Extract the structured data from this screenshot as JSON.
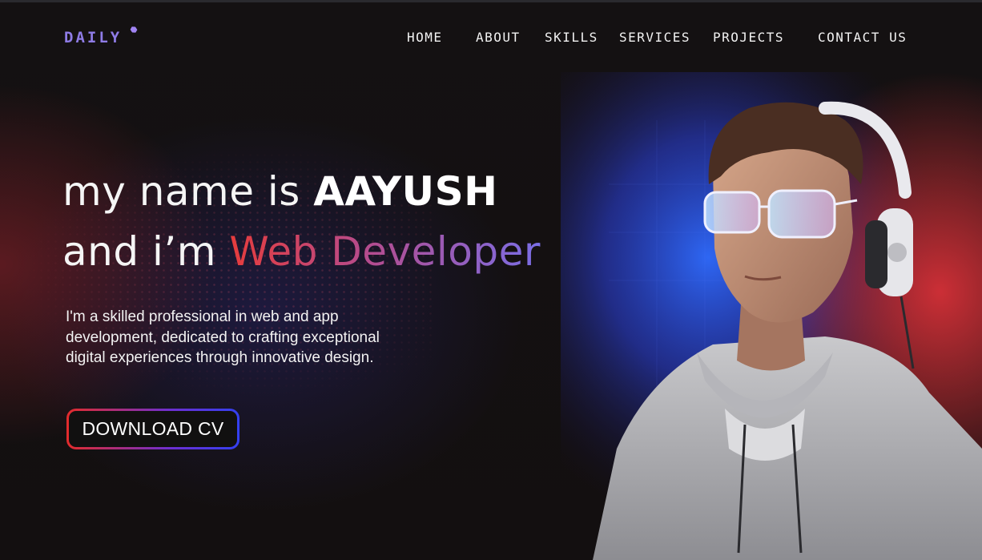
{
  "header": {
    "logo": "DAILY",
    "nav": [
      {
        "label": "HOME"
      },
      {
        "label": "ABOUT"
      },
      {
        "label": "SKILLS"
      },
      {
        "label": "SERVICES"
      },
      {
        "label": "PROJECTS"
      },
      {
        "label": "CONTACT US"
      }
    ]
  },
  "hero": {
    "line1_prefix": "my name is ",
    "name": "AAYUSH",
    "line2_prefix": "and i’m ",
    "role": "Web Developer",
    "description": "I'm a skilled professional in web and app development, dedicated to crafting exceptional digital experiences through innovative design.",
    "cta_label": "DOWNLOAD CV"
  },
  "colors": {
    "background": "#120f10",
    "logo": "#8f7ce6",
    "role_gradient_start": "#e63c3c",
    "role_gradient_end": "#7a6ee6",
    "button_border_start": "#e32b2b",
    "button_border_end": "#3340f0"
  },
  "icons": {
    "logo_mark": "hexagon-dot-icon",
    "portrait": "developer-portrait-illustration"
  }
}
